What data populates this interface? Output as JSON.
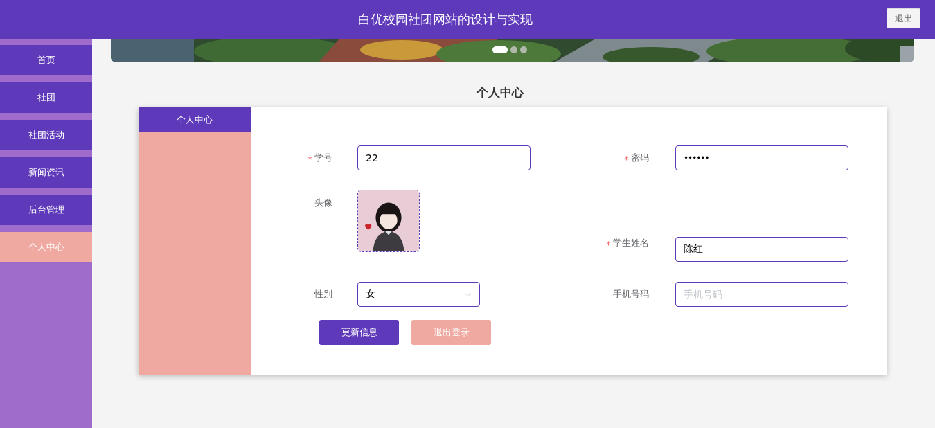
{
  "header": {
    "title": "白优校园社团网站的设计与实现",
    "logout_button": "退出"
  },
  "sidebar": {
    "items": [
      {
        "label": "首页",
        "selected": false
      },
      {
        "label": "社团",
        "selected": false
      },
      {
        "label": "社团活动",
        "selected": false
      },
      {
        "label": "新闻资讯",
        "selected": false
      },
      {
        "label": "后台管理",
        "selected": false
      },
      {
        "label": "个人中心",
        "selected": true
      }
    ]
  },
  "banner": {
    "kind": "picture",
    "indicators": [
      {
        "selected": true
      },
      {
        "selected": false
      },
      {
        "selected": false
      }
    ]
  },
  "page_title": "个人中心",
  "profile_panel": {
    "tabs": [
      {
        "label": "个人中心",
        "selected": true
      }
    ]
  },
  "form": {
    "rows": [
      {
        "left": {
          "kind": "text",
          "label": "学号",
          "required": true,
          "value": "22"
        },
        "right": {
          "kind": "password",
          "label": "密码",
          "required": true,
          "value": "••••••"
        }
      },
      {
        "left": {
          "kind": "avatar",
          "label": "头像",
          "required": false
        },
        "right": {
          "kind": "text",
          "label": "学生姓名",
          "required": true,
          "value": "陈红"
        }
      },
      {
        "left": {
          "kind": "select",
          "label": "性别",
          "required": false,
          "value": "女"
        },
        "right": {
          "kind": "text",
          "label": "手机号码",
          "required": false,
          "placeholder": "手机号码"
        }
      }
    ]
  },
  "buttons": [
    {
      "label": "更新信息",
      "kind": "primary"
    },
    {
      "label": "退出登录",
      "kind": "secondary"
    }
  ]
}
